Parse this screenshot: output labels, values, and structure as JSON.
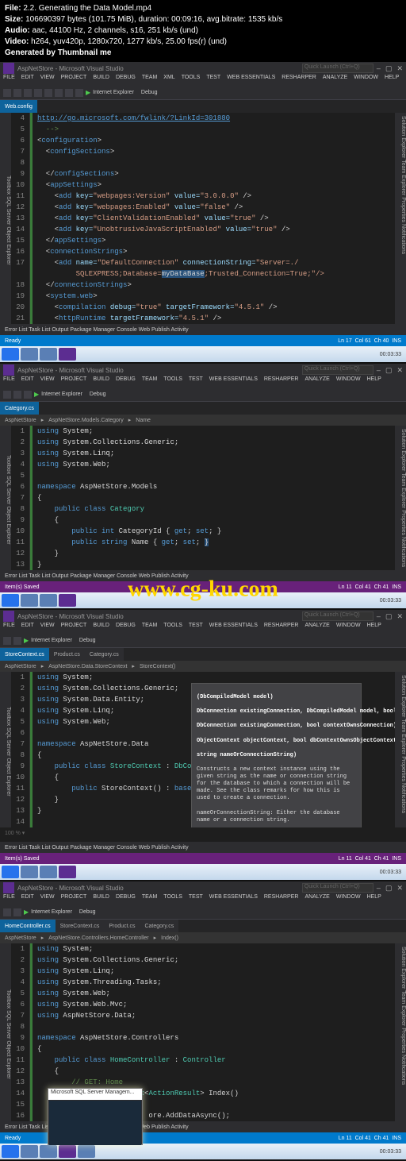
{
  "meta": {
    "file_l": "File:",
    "file_v": "2.2. Generating the Data Model.mp4",
    "size_l": "Size:",
    "size_v": "106690397 bytes (101.75 MiB), duration: 00:09:16, avg.bitrate: 1535 kb/s",
    "audio_l": "Audio:",
    "audio_v": "aac, 44100 Hz, 2 channels, s16, 251 kb/s (und)",
    "video_l": "Video:",
    "video_v": "h264, yuv420p, 1280x720, 1277 kb/s, 25.00 fps(r) (und)",
    "gen": "Generated by Thumbnail me"
  },
  "watermark": "www.cg-ku.com",
  "common": {
    "title": "AspNetStore - Microsoft Visual Studio",
    "quicklaunch": "Quick Launch (Ctrl+Q)",
    "menu": [
      "FILE",
      "EDIT",
      "VIEW",
      "PROJECT",
      "BUILD",
      "DEBUG",
      "TEAM",
      "XML",
      "TOOLS",
      "TEST",
      "WEB ESSENTIALS",
      "RESHARPER",
      "ANALYZE",
      "WINDOW",
      "HELP"
    ],
    "menu_nxml": [
      "FILE",
      "EDIT",
      "VIEW",
      "PROJECT",
      "BUILD",
      "DEBUG",
      "TEAM",
      "TOOLS",
      "TEST",
      "WEB ESSENTIALS",
      "RESHARPER",
      "ANALYZE",
      "WINDOW",
      "HELP"
    ],
    "toolbar_browser": "Internet Explorer",
    "toolbar_debug": "Debug",
    "bottom_tabs": "Error List   Task List   Output   Package Manager Console   Web Publish Activity",
    "status_left": "Ready",
    "status_saved": "Item(s) Saved",
    "status_right_cols": {
      "ln": "Ln 11",
      "col": "Col 41",
      "ch": "Ch 41",
      "ins": "INS"
    },
    "status_right2": {
      "ln": "Ln 17",
      "col": "Col 61",
      "ch": "Ch 40",
      "ins": "INS"
    },
    "clock": "00:03:33",
    "side_left": "Toolbox   SQL Server Object Explorer",
    "side_right": "Solution Explorer   Team Explorer   Properties   Notifications"
  },
  "block1": {
    "tab": "Web.config",
    "lines": [
      4,
      5,
      6,
      7,
      8,
      9,
      10,
      11,
      12,
      13,
      14,
      15,
      16,
      17,
      18,
      19,
      20,
      21
    ],
    "code": {
      "l4": "http://go.microsoft.com/fwlink/?LinkId=301880",
      "l5": "  -->",
      "l6_a": "<",
      "l6_b": "configuration",
      "l6_c": ">",
      "l7_a": "  <",
      "l7_b": "configSections",
      "l7_c": ">",
      "l9_a": "  </",
      "l9_b": "configSections",
      "l9_c": ">",
      "l10_a": "  <",
      "l10_b": "appSettings",
      "l10_c": ">",
      "l11_a": "    <",
      "l11_b": "add",
      "l11_c": " key=",
      "l11_d": "\"webpages:Version\"",
      "l11_e": " value=",
      "l11_f": "\"3.0.0.0\"",
      "l11_g": " />",
      "l12_a": "    <",
      "l12_b": "add",
      "l12_c": " key=",
      "l12_d": "\"webpages:Enabled\"",
      "l12_e": " value=",
      "l12_f": "\"false\"",
      "l12_g": " />",
      "l13_a": "    <",
      "l13_b": "add",
      "l13_c": " key=",
      "l13_d": "\"ClientValidationEnabled\"",
      "l13_e": " value=",
      "l13_f": "\"true\"",
      "l13_g": " />",
      "l14_a": "    <",
      "l14_b": "add",
      "l14_c": " key=",
      "l14_d": "\"UnobtrusiveJavaScriptEnabled\"",
      "l14_e": " value=",
      "l14_f": "\"true\"",
      "l14_g": " />",
      "l15_a": "  </",
      "l15_b": "appSettings",
      "l15_c": ">",
      "l16_a": "  <",
      "l16_b": "connectionStrings",
      "l16_c": ">",
      "l17_a": "    <",
      "l17_b": "add",
      "l17_c": " name=",
      "l17_d": "\"DefaultConnection\"",
      "l17_e": " connectionString=",
      "l17_f1": "\"Server=./",
      "l17_g": "",
      "l17b": "         SQLEXPRESS;Database=",
      "l17b_sel": "myDataBase",
      "l17b_end": ";Trusted_Connection=True;\"/>",
      "l18_a": "  </",
      "l18_b": "connectionStrings",
      "l18_c": ">",
      "l19_a": "  <",
      "l19_b": "system.web",
      "l19_c": ">",
      "l20_a": "    <",
      "l20_b": "compilation",
      "l20_c": " debug=",
      "l20_d": "\"true\"",
      "l20_e": " targetFramework=",
      "l20_f": "\"4.5.1\"",
      "l20_g": " />",
      "l21_a": "    <",
      "l21_b": "httpRuntime",
      "l21_c": " targetFramework=",
      "l21_d": "\"4.5.1\"",
      "l21_e": " />"
    }
  },
  "block2": {
    "tab": "Category.cs",
    "breadcrumb_left": "AspNetStore",
    "breadcrumb_mid": "AspNetStore.Models.Category",
    "breadcrumb_right": "Name",
    "lines": [
      1,
      2,
      3,
      4,
      5,
      6,
      7,
      8,
      9,
      10,
      11,
      12,
      13
    ],
    "code": {
      "l1": "using System;",
      "l2": "using System.Collections.Generic;",
      "l3": "using System.Linq;",
      "l4": "using System.Web;",
      "l5": "",
      "l6": "namespace AspNetStore.Models",
      "l7": "{",
      "l8": "    public class Category",
      "l9": "    {",
      "l10": "        public int CategoryId { get; set; }",
      "l11": "        public string Name { get; set; }",
      "l12": "    }",
      "l13": "}"
    }
  },
  "block3": {
    "tabs": [
      "StoreContext.cs",
      "Product.cs",
      "Category.cs"
    ],
    "breadcrumb_left": "AspNetStore",
    "breadcrumb_mid": "AspNetStore.Data.StoreContext",
    "breadcrumb_right": "StoreContext()",
    "lines": [
      1,
      2,
      3,
      4,
      5,
      6,
      7,
      8,
      9,
      10,
      11,
      12,
      13,
      14
    ],
    "code": {
      "l1": "using System;",
      "l2": "using System.Collections.Generic;",
      "l3": "using System.Data.Entity;",
      "l4": "using System.Linq;",
      "l5": "using System.Web;",
      "l6": "",
      "l7": "namespace AspNetStore.Data",
      "l8": "{",
      "l9": "    public class StoreContext : DbCo",
      "l10": "    {",
      "l11": "        public StoreContext() : base(\"DefaultConnection\")",
      "l12": "    }",
      "l13": "}"
    },
    "tooltip": {
      "h1": "(DbCompiledModel model)",
      "h2": "DbConnection existingConnection, DbCompiledModel model, bool contextOwnsConnection)",
      "h3": "DbConnection existingConnection, bool contextOwnsConnection)",
      "h4": "ObjectContext objectContext, bool dbContextOwnsObjectContext)",
      "h5": "string nameOrConnectionString)",
      "body": "Constructs a new context instance using the given string as the name or connection string for the database to which a connection will be made. See the class remarks for how this is used to create a connection.",
      "param": "nameOrConnectionString: Either the database name or a connection string."
    }
  },
  "block4": {
    "tabs": [
      "HomeController.cs",
      "StoreContext.cs",
      "Product.cs",
      "Category.cs"
    ],
    "breadcrumb_left": "AspNetStore",
    "breadcrumb_mid": "AspNetStore.Controllers.HomeController",
    "breadcrumb_right": "Index()",
    "lines": [
      1,
      2,
      3,
      4,
      5,
      6,
      7,
      8,
      9,
      10,
      11,
      12,
      13,
      14,
      15,
      16
    ],
    "code": {
      "l1": "using System;",
      "l2": "using System.Collections.Generic;",
      "l3": "using System.Linq;",
      "l4": "using System.Threading.Tasks;",
      "l5": "using System.Web;",
      "l6": "using System.Web.Mvc;",
      "l7": "using AspNetStore.Data;",
      "l8": "",
      "l9": "namespace AspNetStore.Controllers",
      "l10": "{",
      "l11": "    public class HomeController : Controller",
      "l12": "    {",
      "l13": "        // GET: Home",
      "l14": "        public async Task<ActionResult> Index()",
      "l15": "        {",
      "l16": "                          ore.AddDataAsync();"
    },
    "thumb_title": "Microsoft SQL Server Managem..."
  }
}
